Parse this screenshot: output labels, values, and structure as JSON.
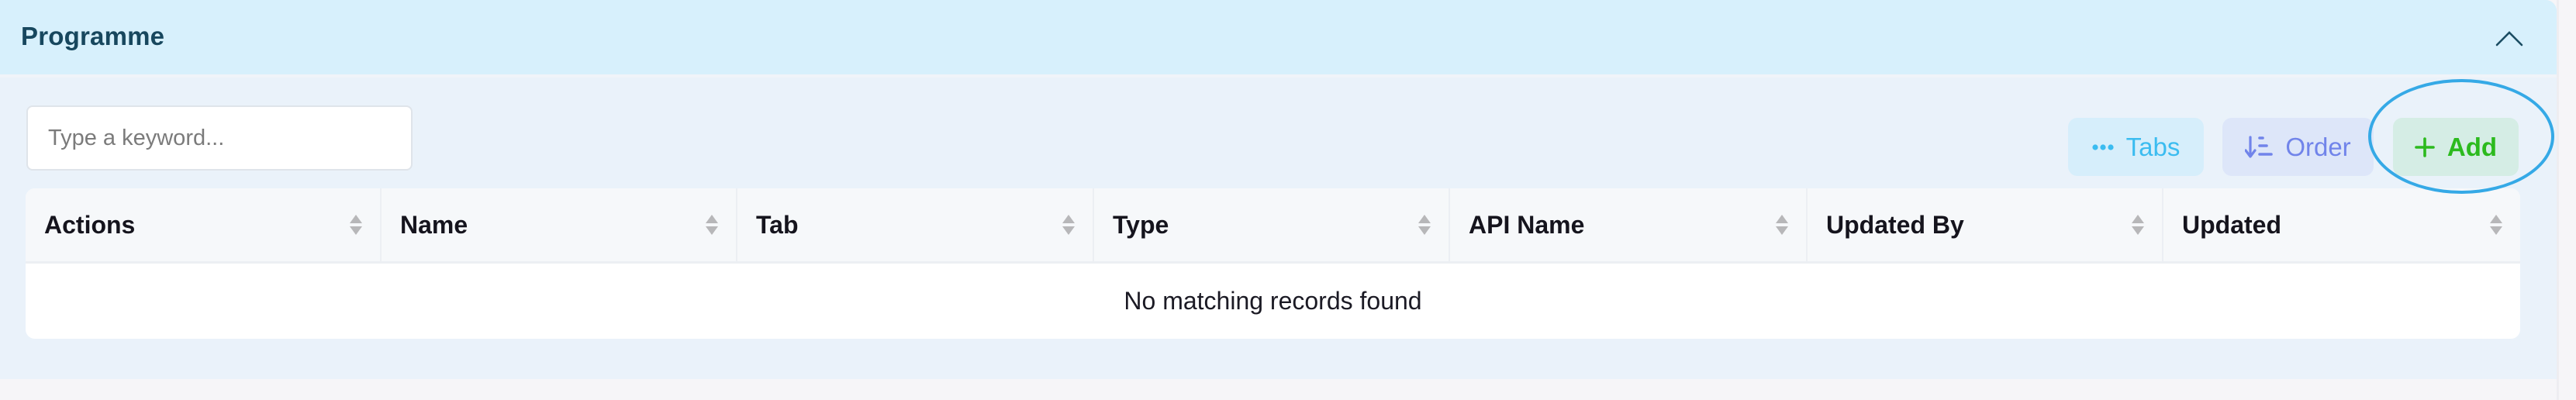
{
  "panel": {
    "title": "Programme",
    "collapse_icon": "chevron-up-icon"
  },
  "search": {
    "placeholder": "Type a keyword...",
    "value": ""
  },
  "toolbar": {
    "buttons": [
      {
        "label": "Tabs",
        "icon": "ellipsis-icon",
        "color": "#3bbcf0"
      },
      {
        "label": "Order",
        "icon": "sort-ascending-icon",
        "color": "#7184ea"
      },
      {
        "label": "Add",
        "icon": "plus-icon",
        "color": "#2cba1e"
      }
    ]
  },
  "table": {
    "columns": [
      {
        "label": "Actions"
      },
      {
        "label": "Name"
      },
      {
        "label": "Tab"
      },
      {
        "label": "Type"
      },
      {
        "label": "API Name"
      },
      {
        "label": "Updated By"
      },
      {
        "label": "Updated"
      }
    ],
    "rows": [],
    "empty_message": "No matching records found"
  },
  "annotation": {
    "highlight_target": "Add",
    "color": "#35a9e6"
  }
}
